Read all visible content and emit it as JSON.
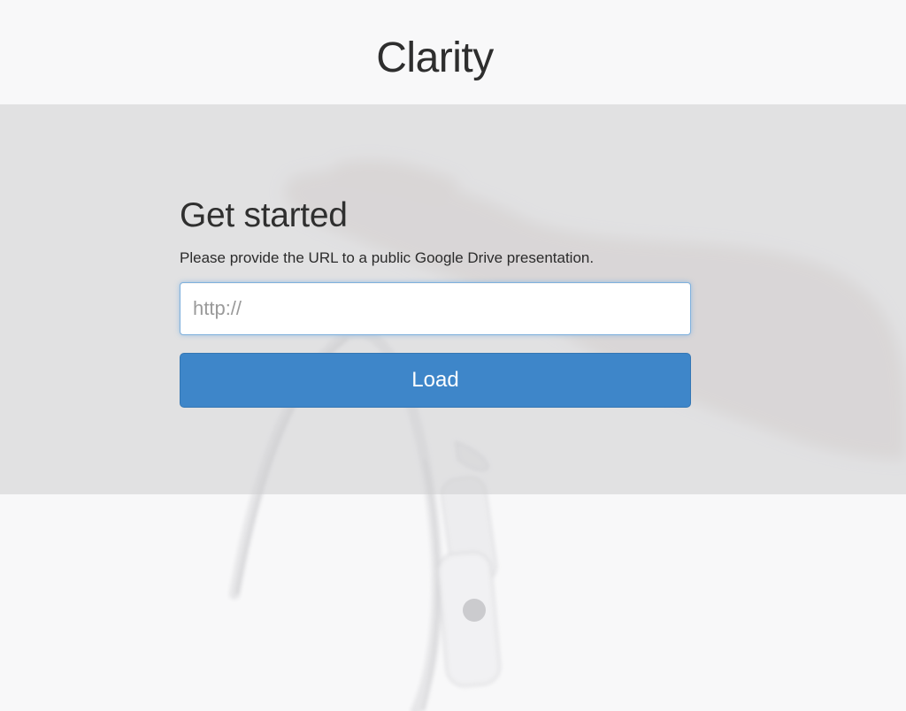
{
  "app": {
    "title": "Clarity"
  },
  "get_started": {
    "heading": "Get started",
    "instructions": "Please provide the URL to a public Google Drive presentation."
  },
  "url_field": {
    "placeholder": "http://",
    "value": ""
  },
  "actions": {
    "load_label": "Load"
  },
  "colors": {
    "page_background": "#f8f8f9",
    "band_overlay": "#cececf",
    "primary_button": "#3e86c9",
    "input_focus_border": "#7fb0dc",
    "title_text": "#2e2e2e"
  },
  "background_image": {
    "subject": "hand-and-glasses-photo"
  }
}
